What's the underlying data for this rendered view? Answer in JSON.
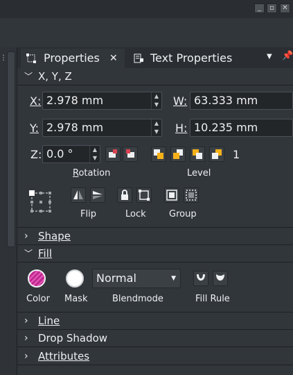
{
  "window": {
    "minimize_icon": "minimize-icon",
    "restore_icon": "restore-icon",
    "close_icon": "close-icon"
  },
  "tabs": [
    {
      "label": "Properties",
      "close": "✕"
    },
    {
      "label": "Text Properties"
    }
  ],
  "xyz": {
    "section_label": "X, Y, Z",
    "x_label": "X:",
    "x_value": "2.978 mm",
    "y_label": "Y:",
    "y_value": "2.978 mm",
    "w_label": "W:",
    "w_value": "63.333 mm",
    "h_label": "H:",
    "h_value": "10.235 mm",
    "z_label": "Z:",
    "z_value": "0.0 °",
    "rotation_caption": "Rotation",
    "level_caption": "Level",
    "level_value": "1",
    "flip_caption": "Flip",
    "lock_caption": "Lock",
    "group_caption": "Group"
  },
  "sections": {
    "shape": "Shape",
    "fill": "Fill",
    "line": "Line",
    "drop_shadow": "Drop Shadow",
    "attributes": "Attributes"
  },
  "fill": {
    "color_caption": "Color",
    "mask_caption": "Mask",
    "blendmode_caption": "Blendmode",
    "blendmode_value": "Normal",
    "fill_rule_caption": "Fill Rule",
    "color_swatch": "#c0288f",
    "mask_swatch": "#ffffff"
  }
}
